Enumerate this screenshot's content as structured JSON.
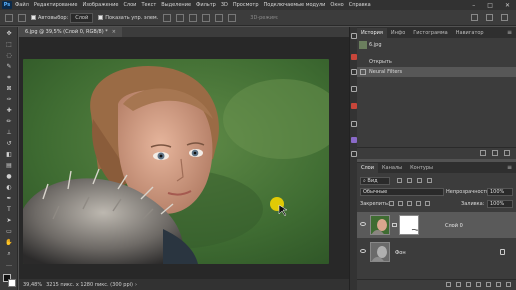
{
  "app": {
    "logo": "Ps"
  },
  "menu": [
    "Файл",
    "Редактирование",
    "Изображение",
    "Слои",
    "Текст",
    "Выделение",
    "Фильтр",
    "3D",
    "Просмотр",
    "Подключаемые модули",
    "Окно",
    "Справка"
  ],
  "options": {
    "autoselect_label": "Автовыбор:",
    "autoselect_value": "Слой",
    "show_controls_label": "Показать упр. элем.",
    "mode_3d_label": "3D-режим:"
  },
  "document": {
    "tab_title": "6.jpg @ 39,5% (Слой 0, RGB/8) *",
    "zoom": "39,48%",
    "size_info": "3215 пикс. x 1280 пикс. (300 ppi)"
  },
  "history_panel": {
    "tabs": [
      "История",
      "Инфо",
      "Гистограмма",
      "Навигатор"
    ],
    "snapshot": "6.jpg",
    "items": [
      "Открыть",
      "Neural Filters"
    ]
  },
  "layers_panel": {
    "tabs": [
      "Слои",
      "Каналы",
      "Контуры"
    ],
    "filter_kind": "Вид",
    "blend_mode": "Обычные",
    "opacity_label": "Непрозрачность:",
    "opacity_value": "100%",
    "lock_label": "Закрепить:",
    "fill_label": "Заливка:",
    "fill_value": "100%",
    "layers": [
      {
        "name": "Слой 0"
      },
      {
        "name": "Фон"
      }
    ]
  },
  "icons": [
    "move-icon",
    "marquee-icon",
    "lasso-icon",
    "quick-select-icon",
    "crop-icon",
    "eyedropper-icon",
    "healing-icon",
    "brush-icon",
    "stamp-icon",
    "history-brush-icon",
    "eraser-icon",
    "gradient-icon",
    "blur-icon",
    "dodge-icon",
    "pen-icon",
    "type-icon",
    "path-select-icon",
    "shape-icon",
    "hand-icon",
    "zoom-icon",
    "eye-icon",
    "lock-icon"
  ],
  "colors": {
    "accent_red": "#c8463a",
    "panel_bg": "#3c3c3c",
    "canvas_bg": "#282828"
  }
}
